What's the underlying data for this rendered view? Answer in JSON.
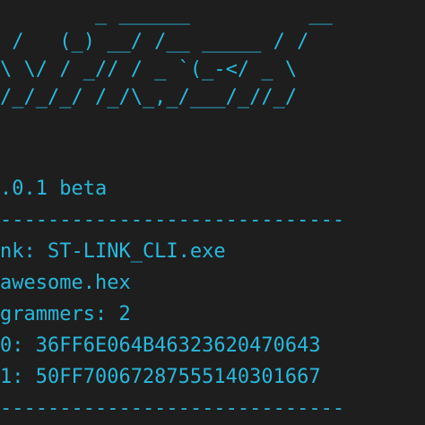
{
  "banner": {
    "lines": [
      "        _ ______          __  ",
      " /   (_) __/ /__ _____ / /  ",
      "\\ \\/ / _// / _ `(_-</ _ \\ ",
      "/_/_/_/ /_/\\_,_/___/_//_/ "
    ]
  },
  "output": {
    "version": ".0.1 beta",
    "divider_top": "-----------------------------",
    "link": "nk: ST-LINK_CLI.exe",
    "file": "awesome.hex",
    "programmers": "grammers: 2",
    "programmer_0": "0: 36FF6E064B46323620470643",
    "programmer_1": "1: 50FF70067287555140301667",
    "divider_bottom": "-----------------------------"
  },
  "colors": {
    "background": "#1e1e1e",
    "text": "#29b8db"
  }
}
